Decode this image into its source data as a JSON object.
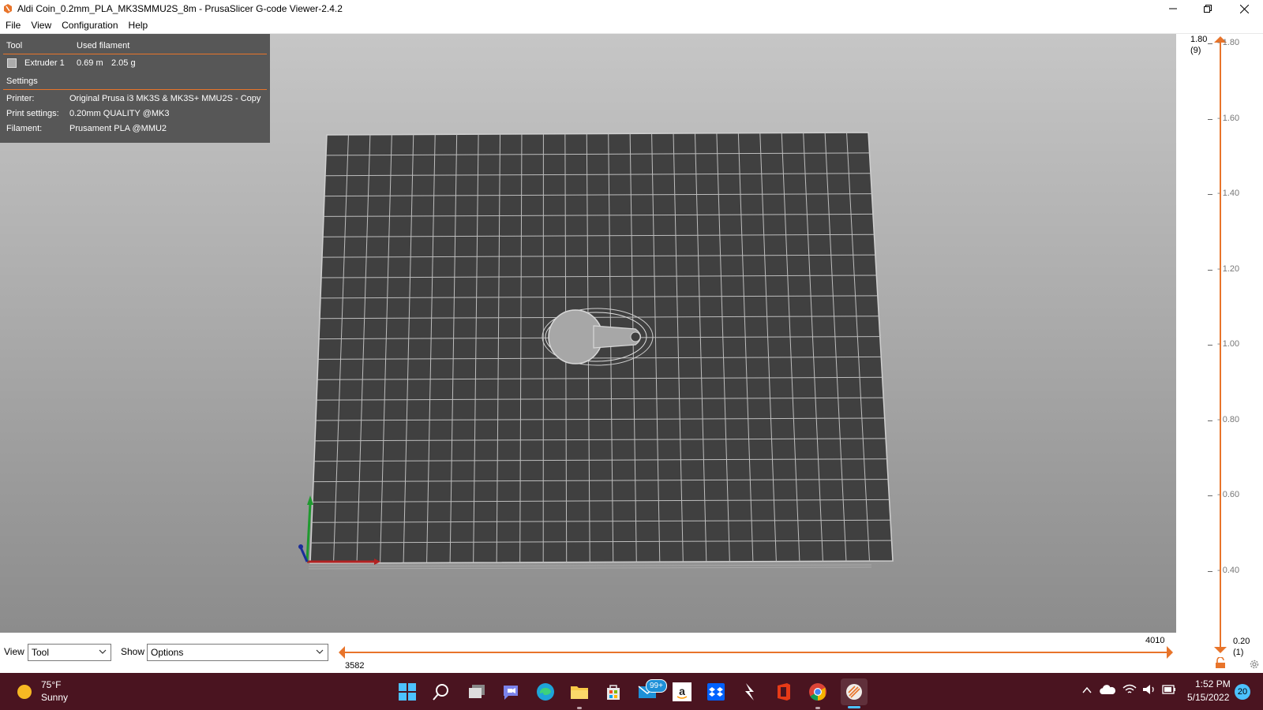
{
  "window": {
    "title": "Aldi Coin_0.2mm_PLA_MK3SMMU2S_8m - PrusaSlicer G-code Viewer-2.4.2",
    "icons": [
      "prusa-app-icon",
      "minimize-icon",
      "restore-icon",
      "close-icon"
    ]
  },
  "menu": [
    "File",
    "View",
    "Configuration",
    "Help"
  ],
  "legend": {
    "tool_header": "Tool",
    "filament_header": "Used filament",
    "extruder_name": "Extruder 1",
    "extruder_length": "0.69 m",
    "extruder_weight": "2.05 g",
    "extruder_color": "#ababab",
    "settings_header": "Settings",
    "printer_label": "Printer:",
    "printer_value": "Original Prusa i3 MK3S & MK3S+ MMU2S - Copy",
    "print_settings_label": "Print settings:",
    "print_settings_value": "0.20mm QUALITY @MK3",
    "filament_label": "Filament:",
    "filament_value": "Prusament PLA @MMU2"
  },
  "layer_slider": {
    "top_value": "1.80",
    "top_layer": "(9)",
    "bottom_value": "0.20",
    "bottom_layer": "(1)",
    "ticks": [
      "1.80",
      "1.60",
      "1.40",
      "1.20",
      "1.00",
      "0.80",
      "0.60",
      "0.40"
    ],
    "accent_color": "#e8742a"
  },
  "bottom": {
    "view_label": "View",
    "view_value": "Tool",
    "show_label": "Show",
    "show_value": "Options",
    "move_max": "4010",
    "move_min": "3582"
  },
  "taskbar": {
    "weather_temp": "75°F",
    "weather_desc": "Sunny",
    "mail_badge": "99+",
    "time": "1:52 PM",
    "date": "5/15/2022",
    "notification_count": "20",
    "background": "#4a1420"
  }
}
